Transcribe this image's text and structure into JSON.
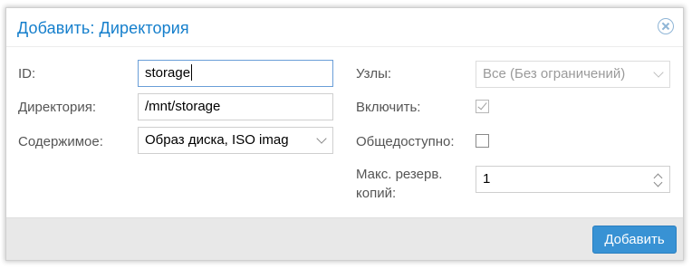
{
  "dialog": {
    "title": "Добавить: Директория",
    "close_icon": "close-circle-icon"
  },
  "left": {
    "id_label": "ID:",
    "id_value": "storage",
    "directory_label": "Директория:",
    "directory_value": "/mnt/storage",
    "content_label": "Содержимое:",
    "content_value": "Образ диска, ISO imag"
  },
  "right": {
    "nodes_label": "Узлы:",
    "nodes_value": "Все (Без ограничений)",
    "enable_label": "Включить:",
    "enable_checked": true,
    "shared_label": "Общедоступно:",
    "shared_checked": false,
    "max_backups_label_line1": "Макс. резерв.",
    "max_backups_label_line2": "копий:",
    "max_backups_value": "1"
  },
  "footer": {
    "add_label": "Добавить"
  },
  "colors": {
    "title": "#157fcc",
    "primary_button": "#3892d4",
    "footer_bg": "#e8e8e8"
  }
}
